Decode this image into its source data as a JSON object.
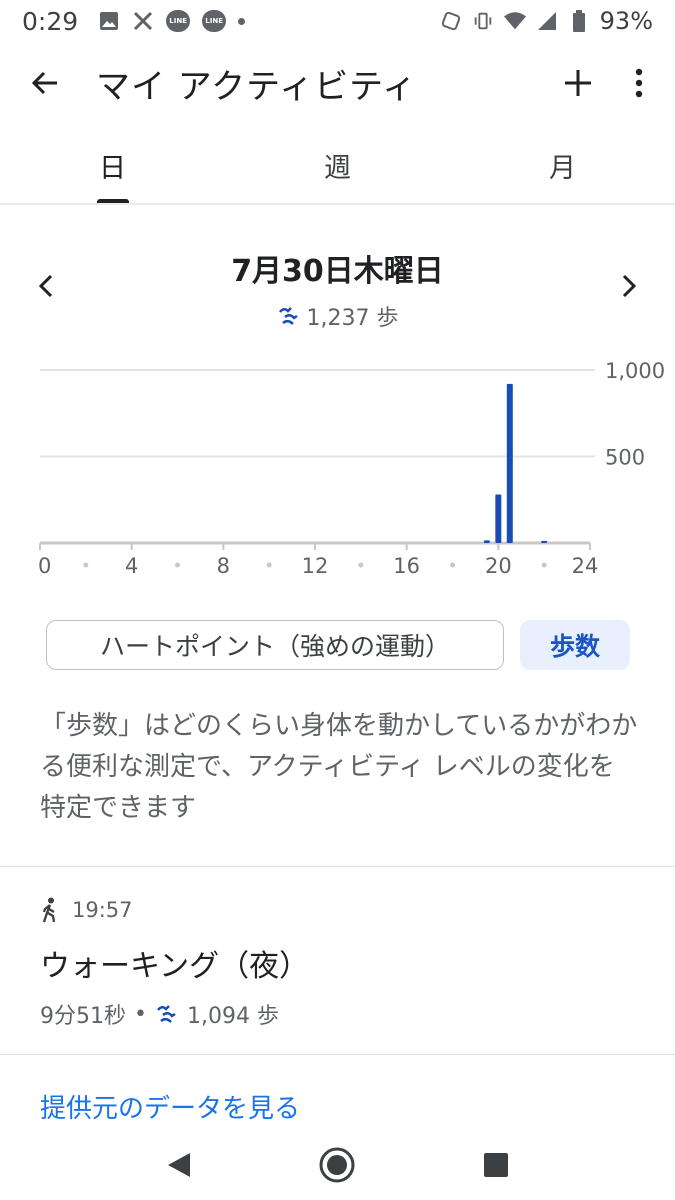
{
  "status_bar": {
    "time": "0:29",
    "battery": "93%",
    "line_label": "LINE"
  },
  "app_bar": {
    "title": "マイ アクティビティ"
  },
  "tabs": [
    {
      "label": "日",
      "active": true
    },
    {
      "label": "週",
      "active": false
    },
    {
      "label": "月",
      "active": false
    }
  ],
  "date": {
    "title": "7月30日木曜日",
    "steps": "1,237 歩"
  },
  "chart_data": {
    "type": "bar",
    "x_ticks": [
      "0",
      "4",
      "8",
      "12",
      "16",
      "20",
      "24"
    ],
    "y_ticks": [
      "1,000",
      "500"
    ],
    "xlim": [
      0,
      24
    ],
    "ylim": [
      0,
      1000
    ],
    "bars": [
      {
        "x": 19.5,
        "value": 15
      },
      {
        "x": 20.0,
        "value": 280
      },
      {
        "x": 20.5,
        "value": 920
      },
      {
        "x": 22.0,
        "value": 12
      }
    ],
    "bar_color": "#1a4db3"
  },
  "chips": {
    "heart_points": "ハートポイント（強めの運動）",
    "steps": "歩数"
  },
  "description": "「歩数」はどのくらい身体を動かしているかがわかる便利な測定で、アクティビティ レベルの変化を特定できます",
  "activity": {
    "time": "19:57",
    "title": "ウォーキング（夜）",
    "duration": "9分51秒",
    "separator": "•",
    "steps": "1,094 歩"
  },
  "link": {
    "label": "提供元のデータを見る"
  },
  "colors": {
    "accent": "#1a73e8",
    "chip_bg": "#e8f0fe"
  }
}
